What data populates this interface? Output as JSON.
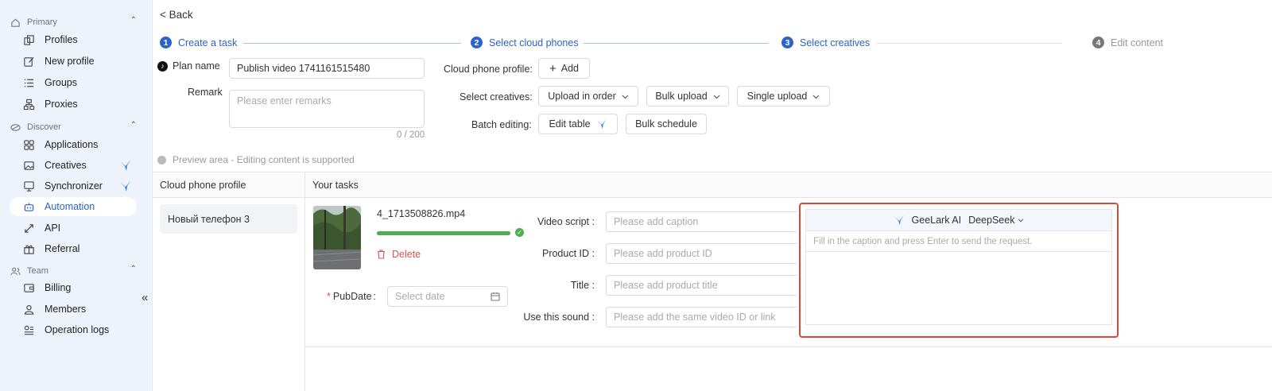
{
  "sidebar": {
    "sections": {
      "primary": "Primary",
      "discover": "Discover",
      "team": "Team"
    },
    "items": {
      "profiles": "Profiles",
      "new_profile": "New profile",
      "groups": "Groups",
      "proxies": "Proxies",
      "applications": "Applications",
      "creatives": "Creatives",
      "synchronizer": "Synchronizer",
      "automation": "Automation",
      "api": "API",
      "referral": "Referral",
      "billing": "Billing",
      "members": "Members",
      "operation_logs": "Operation logs"
    },
    "collapse_glyph": "«",
    "active_item": "Automation"
  },
  "header": {
    "back": "< Back"
  },
  "steps": [
    {
      "num": "1",
      "label": "Create a task",
      "state": "done"
    },
    {
      "num": "2",
      "label": "Select cloud phones",
      "state": "done"
    },
    {
      "num": "3",
      "label": "Select creatives",
      "state": "current"
    },
    {
      "num": "4",
      "label": "Edit content",
      "state": "todo"
    }
  ],
  "form": {
    "plan_name_label": "Plan name",
    "plan_name_value": "Publish video 1741161515480",
    "remark_label": "Remark",
    "remark_placeholder": "Please enter remarks",
    "remark_count": "0 / 200",
    "cloud_phone_profile_label": "Cloud phone profile:",
    "add_button": "Add",
    "select_creatives_label": "Select creatives:",
    "upload_in_order": "Upload in order",
    "bulk_upload": "Bulk upload",
    "single_upload": "Single upload",
    "batch_editing_label": "Batch editing:",
    "edit_table": "Edit table",
    "bulk_schedule": "Bulk schedule"
  },
  "preview": {
    "text": "Preview area - Editing content is supported"
  },
  "table": {
    "col_profile": "Cloud phone profile",
    "col_tasks": "Your tasks",
    "phone_name": "Новый телефон 3"
  },
  "task": {
    "file_name": "4_1713508826.mp4",
    "upload_progress": 1.0,
    "delete": "Delete",
    "pubdate_required": "*",
    "pubdate_label": "PubDate",
    "pubdate_placeholder": "Select date",
    "video_script_label": "Video script",
    "video_script_placeholder": "Please add caption",
    "product_id_label": "Product ID",
    "product_id_placeholder": "Please add product ID",
    "title_label": "Title",
    "title_placeholder": "Please add product title",
    "sound_label": "Use this sound",
    "sound_placeholder": "Please add the same video ID or link"
  },
  "ai_panel": {
    "brand": "GeeLark AI",
    "model": "DeepSeek",
    "hint": "Fill in the caption and press Enter to send the request."
  },
  "colors": {
    "accent": "#2c62c9",
    "sidebar_bg": "#eef3fb",
    "success": "#4caf50",
    "danger": "#d9534f",
    "highlight_border": "#d84a38"
  }
}
